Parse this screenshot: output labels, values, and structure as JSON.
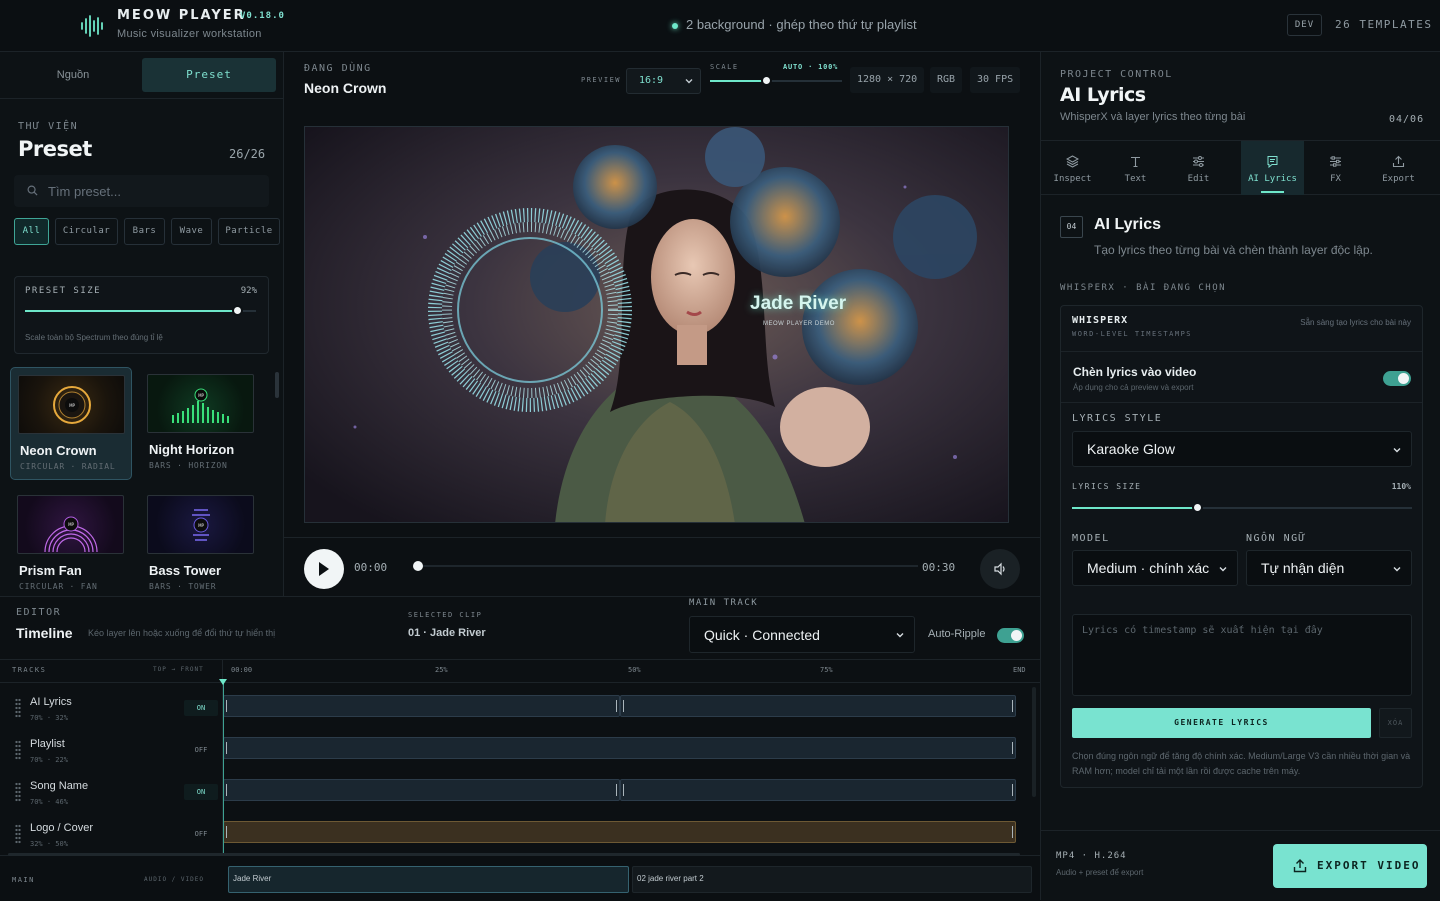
{
  "app": {
    "title": "MEOW PLAYER",
    "version": "V0.18.0",
    "subtitle": "Music visualizer workstation",
    "status": "2 background · ghép theo thứ tự playlist",
    "env_badge": "DEV",
    "templates": "26 TEMPLATES"
  },
  "colors": {
    "accent": "#6ee7c9",
    "accent_dark": "#3ea192",
    "background": "#0c1013",
    "panel": "#0d1215"
  },
  "left_panel": {
    "tabs": [
      "Nguồn",
      "Preset"
    ],
    "active_tab": "Preset",
    "library_eyebrow": "THƯ VIỆN",
    "library_title": "Preset",
    "library_count": "26/26",
    "search_placeholder": "Tìm preset...",
    "filters": [
      "All",
      "Circular",
      "Bars",
      "Wave",
      "Particle"
    ],
    "active_filter": "All",
    "preset_size": {
      "label": "PRESET SIZE",
      "value_text": "92%",
      "value": 0.92,
      "hint": "Scale toàn bộ Spectrum theo đúng tỉ lệ"
    },
    "presets": [
      {
        "name": "Neon Crown",
        "tag": "CIRCULAR · RADIAL",
        "selected": true,
        "icon": "ring-spectrum-icon"
      },
      {
        "name": "Night Horizon",
        "tag": "BARS · HORIZON",
        "selected": false,
        "icon": "bars-spectrum-icon"
      },
      {
        "name": "Prism Fan",
        "tag": "CIRCULAR · FAN",
        "selected": false,
        "icon": "fan-spectrum-icon"
      },
      {
        "name": "Bass Tower",
        "tag": "BARS · TOWER",
        "selected": false,
        "icon": "tower-spectrum-icon"
      }
    ]
  },
  "stage": {
    "eyebrow": "ĐANG DÙNG",
    "title": "Neon Crown",
    "preview_label": "PREVIEW",
    "preview_value": "16:9",
    "scale_label": "SCALE",
    "scale_value_text": "AUTO · 100%",
    "scale_value": 0.43,
    "resolution": "1280 × 720",
    "color_mode": "RGB",
    "fps": "30 FPS",
    "overlay_title": "Jade River",
    "overlay_subtitle": "MEOW PLAYER DEMO",
    "time_current": "00:00",
    "time_total": "00:30",
    "progress": 0
  },
  "right_panel": {
    "eyebrow": "PROJECT CONTROL",
    "title": "AI Lyrics",
    "subtitle": "WhisperX và layer lyrics theo từng bài",
    "step": "04/06",
    "tabs": [
      {
        "label": "Inspect",
        "icon": "layers-icon"
      },
      {
        "label": "Text",
        "icon": "text-icon"
      },
      {
        "label": "Edit",
        "icon": "sliders-icon"
      },
      {
        "label": "AI Lyrics",
        "icon": "lyrics-icon"
      },
      {
        "label": "FX",
        "icon": "fx-icon"
      },
      {
        "label": "Export",
        "icon": "upload-icon"
      }
    ],
    "active_tab": "AI Lyrics",
    "section": {
      "number": "04",
      "title": "AI Lyrics",
      "subtitle": "Tạo lyrics theo từng bài và chèn thành layer độc lập."
    },
    "whisperx_eyebrow": "WHISPERX · BÀI ĐANG CHỌN",
    "whisperx": {
      "title": "WHISPERX",
      "subtitle": "WORD-LEVEL TIMESTAMPS",
      "ready": "Sẵn sàng tạo lyrics cho bài này",
      "insert_title": "Chèn lyrics vào video",
      "insert_subtitle": "Áp dụng cho cả preview và export",
      "insert_enabled": true,
      "style_label": "LYRICS STYLE",
      "style_value": "Karaoke Glow",
      "size_label": "LYRICS SIZE",
      "size_value_text": "110%",
      "size_value": 0.37,
      "model_label": "MODEL",
      "model_value": "Medium · chính xác",
      "lang_label": "NGÔN NGỮ",
      "lang_value": "Tự nhận diện",
      "lyrics_placeholder": "Lyrics có timestamp sẽ xuất hiện tại đây",
      "generate_label": "GENERATE LYRICS",
      "clear_label": "XÓA",
      "note": "Chọn đúng ngôn ngữ để tăng độ chính xác. Medium/Large V3 cần nhiều thời gian và RAM hơn; model chỉ tải một lần rồi được cache trên máy."
    },
    "footer": {
      "format": "MP4 · H.264",
      "format_sub": "Audio + preset để export",
      "export_label": "EXPORT VIDEO"
    }
  },
  "editor": {
    "eyebrow": "EDITOR",
    "title": "Timeline",
    "hint": "Kéo layer lên hoặc xuống để đổi thứ tự hiển thị",
    "selected_clip_label": "SELECTED CLIP",
    "selected_clip": "01 · Jade River",
    "main_track_label": "MAIN TRACK",
    "main_track_value": "Quick · Connected",
    "auto_ripple_label": "Auto-Ripple",
    "auto_ripple": true,
    "tracks_label": "TRACKS",
    "order_label": "TOP → FRONT",
    "ruler": [
      "00:00",
      "25%",
      "50%",
      "75%",
      "END"
    ],
    "tracks": [
      {
        "name": "AI Lyrics",
        "meta": "70% · 32%",
        "state": "ON"
      },
      {
        "name": "Playlist",
        "meta": "70% · 22%",
        "state": "OFF"
      },
      {
        "name": "Song Name",
        "meta": "70% · 46%",
        "state": "ON"
      },
      {
        "name": "Logo / Cover",
        "meta": "32% · 50%",
        "state": "OFF"
      }
    ],
    "main_label": "MAIN",
    "av_label": "AUDIO / VIDEO",
    "clips": [
      "Jade River",
      "02 jade river part 2"
    ]
  }
}
